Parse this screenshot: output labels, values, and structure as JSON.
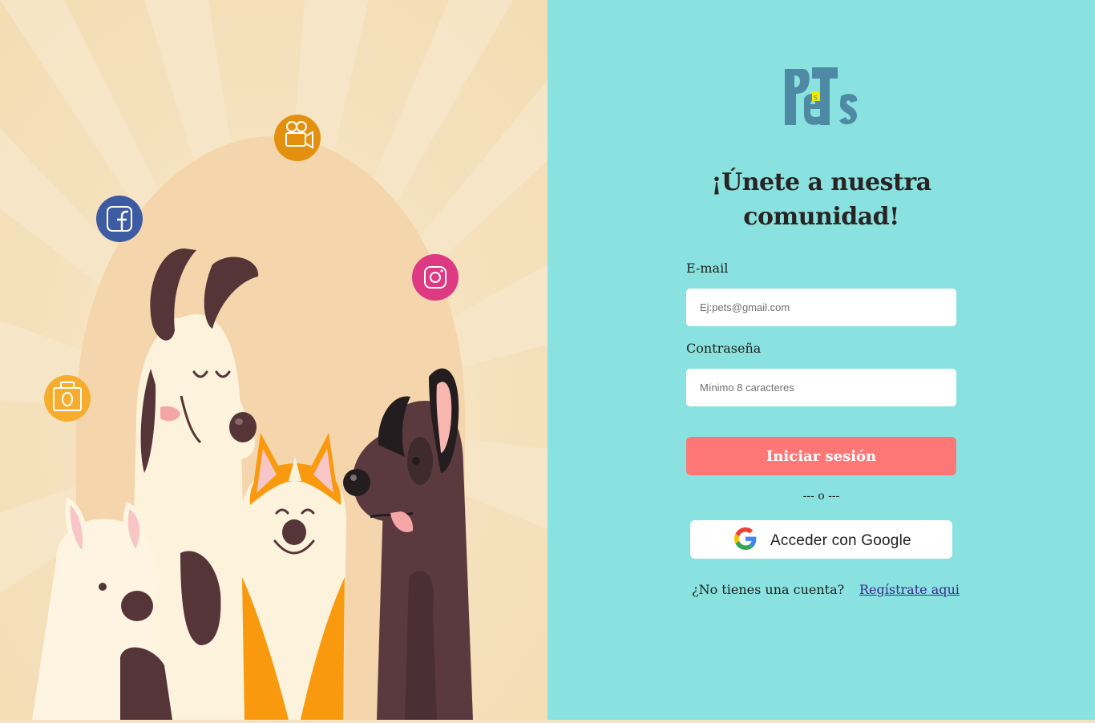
{
  "brand": {
    "logo_text": "PeTs"
  },
  "hero": {
    "social_icons": [
      "video-camera-icon",
      "facebook-icon",
      "instagram-icon",
      "shopping-bag-icon"
    ]
  },
  "form": {
    "title": "¡Únete a nuestra comunidad!",
    "email_label": "E-mail",
    "email_placeholder": "Ej:pets@gmail.com",
    "email_value": "",
    "password_label": "Contraseña",
    "password_placeholder": "Mínimo 8 caracteres",
    "password_value": "",
    "login_button": "Iniciar sesión",
    "divider": "--- o ---",
    "google_button": "Acceder con Google",
    "no_account_text": "¿No tienes una cuenta?",
    "register_link": "Regístrate aqui"
  },
  "colors": {
    "right_background": "#89e2df",
    "login_button": "#fd7777",
    "logo": "#4f8aa4",
    "link": "#3a2a8c",
    "left_background": "#f5e6c8"
  }
}
